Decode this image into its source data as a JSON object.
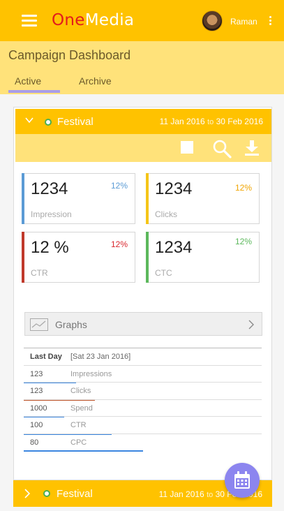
{
  "app": {
    "brand_one": "One",
    "brand_media": "Media",
    "user_name": "Raman"
  },
  "header": {
    "title": "Campaign Dashboard",
    "tabs": [
      {
        "label": "Active",
        "selected": true
      },
      {
        "label": "Archive",
        "selected": false
      }
    ]
  },
  "campaigns": [
    {
      "name": "Festival",
      "start": "11 Jan 2016",
      "to": "to",
      "end": "30 Feb 2016",
      "expanded": true,
      "stats": [
        {
          "value": "1234",
          "change": "12%",
          "label": "Impression",
          "color": "#5b9bd5"
        },
        {
          "value": "1234",
          "change": "12%",
          "label": "Clicks",
          "color": "#f5c518"
        },
        {
          "value": "12 %",
          "change": "12%",
          "label": "CTR",
          "color": "#c0392b"
        },
        {
          "value": "1234",
          "change": "12%",
          "label": "CTC",
          "color": "#5cb85c"
        }
      ],
      "graphs_label": "Graphs",
      "table": {
        "head": {
          "col1": "Last Day",
          "col2": "[Sat 23 Jan 2016]"
        },
        "rows": [
          {
            "value": "123",
            "metric": "Impressions",
            "bar_color": "#3b86e0",
            "bar_fraction": 0.22
          },
          {
            "value": "123",
            "metric": "Clicks",
            "bar_color": "#c0552a",
            "bar_fraction": 0.3
          },
          {
            "value": "1000",
            "metric": "Spend",
            "bar_color": "#3b86e0",
            "bar_fraction": 0.17
          },
          {
            "value": "100",
            "metric": "CTR",
            "bar_color": "#3b86e0",
            "bar_fraction": 0.37
          },
          {
            "value": "80",
            "metric": "CPC",
            "bar_color": "#3b86e0",
            "bar_fraction": 0.5
          }
        ]
      }
    },
    {
      "name": "Festival",
      "start": "11 Jan 2016",
      "to": "to",
      "end": "30 Feb 2016",
      "expanded": false
    }
  ],
  "colors": {
    "primary": "#ffc200",
    "primary_light": "#ffe27a",
    "accent": "#8c85ef",
    "status_active": "#4caf50"
  },
  "icons": [
    "menu-icon",
    "kebab-icon",
    "chevron-down-icon",
    "stop-icon",
    "search-icon",
    "download-icon",
    "graph-icon",
    "chevron-right-icon",
    "calendar-icon"
  ]
}
